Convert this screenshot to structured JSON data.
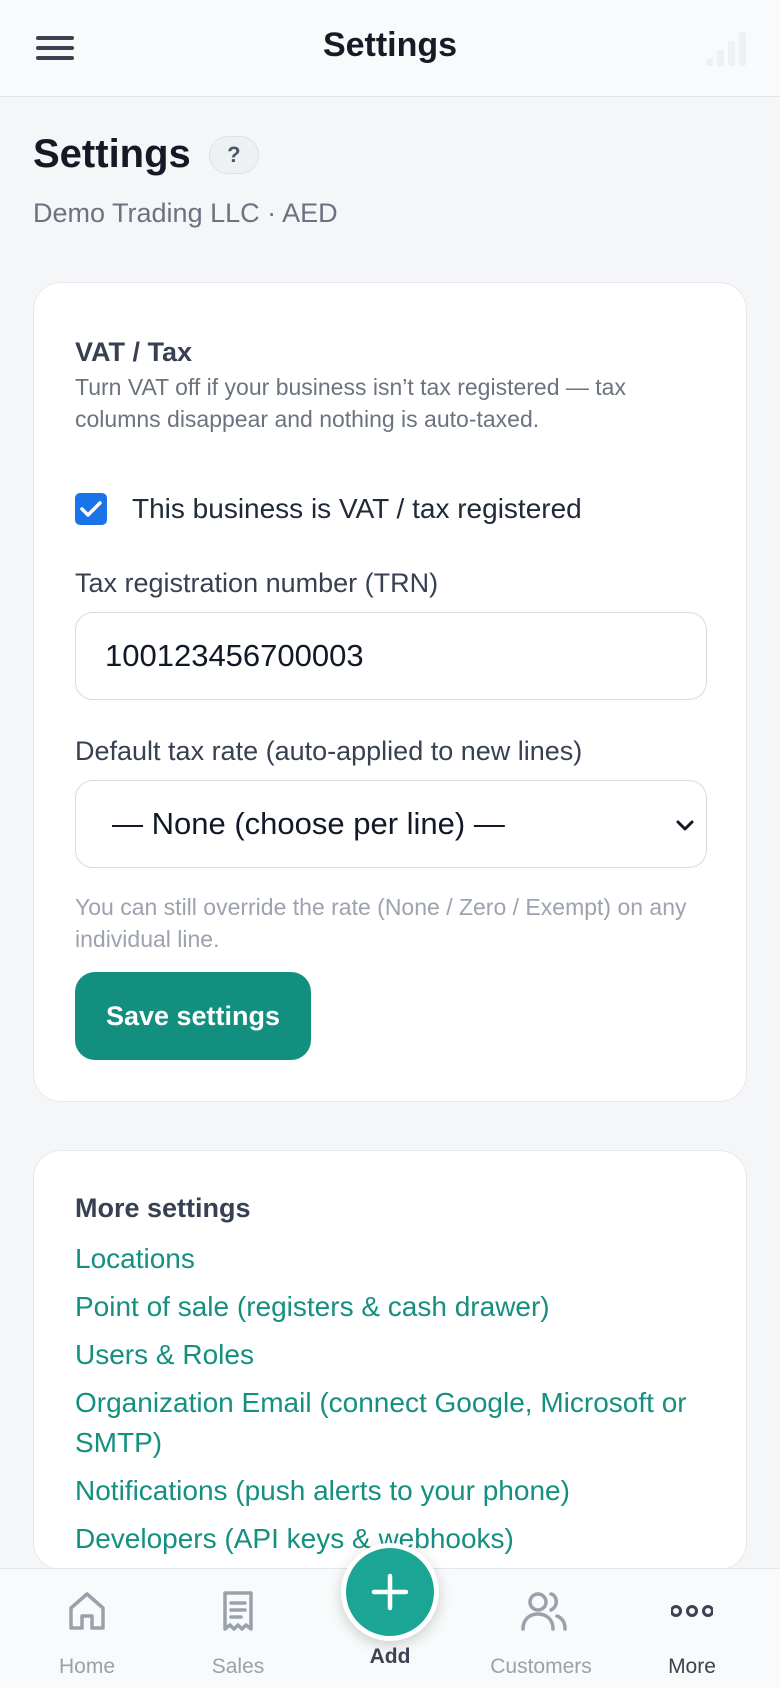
{
  "topbar": {
    "title": "Settings"
  },
  "page": {
    "title": "Settings",
    "help_label": "?",
    "org_line": "Demo Trading LLC · AED"
  },
  "vat": {
    "heading": "VAT / Tax",
    "description": "Turn VAT off if your business isn’t tax registered — tax columns disappear and nothing is auto-taxed.",
    "checkbox_label": "This business is VAT / tax registered",
    "checkbox_checked": true,
    "trn_label": "Tax registration number (TRN)",
    "trn_value": "100123456700003",
    "rate_label": "Default tax rate (auto-applied to new lines)",
    "rate_value": "— None (choose per line) —",
    "hint": "You can still override the rate (None / Zero / Exempt) on any individual line.",
    "save_label": "Save settings"
  },
  "more": {
    "heading": "More settings",
    "links": [
      "Locations",
      "Point of sale (registers & cash drawer)",
      "Users & Roles",
      "Organization Email (connect Google, Microsoft or SMTP)",
      "Notifications (push alerts to your phone)",
      "Developers (API keys & webhooks)"
    ]
  },
  "nav": {
    "home": "Home",
    "sales": "Sales",
    "add": "Add",
    "customers": "Customers",
    "more": "More"
  },
  "colors": {
    "accent": "#138f7f",
    "link": "#158f80",
    "checkbox": "#1a73e8"
  }
}
